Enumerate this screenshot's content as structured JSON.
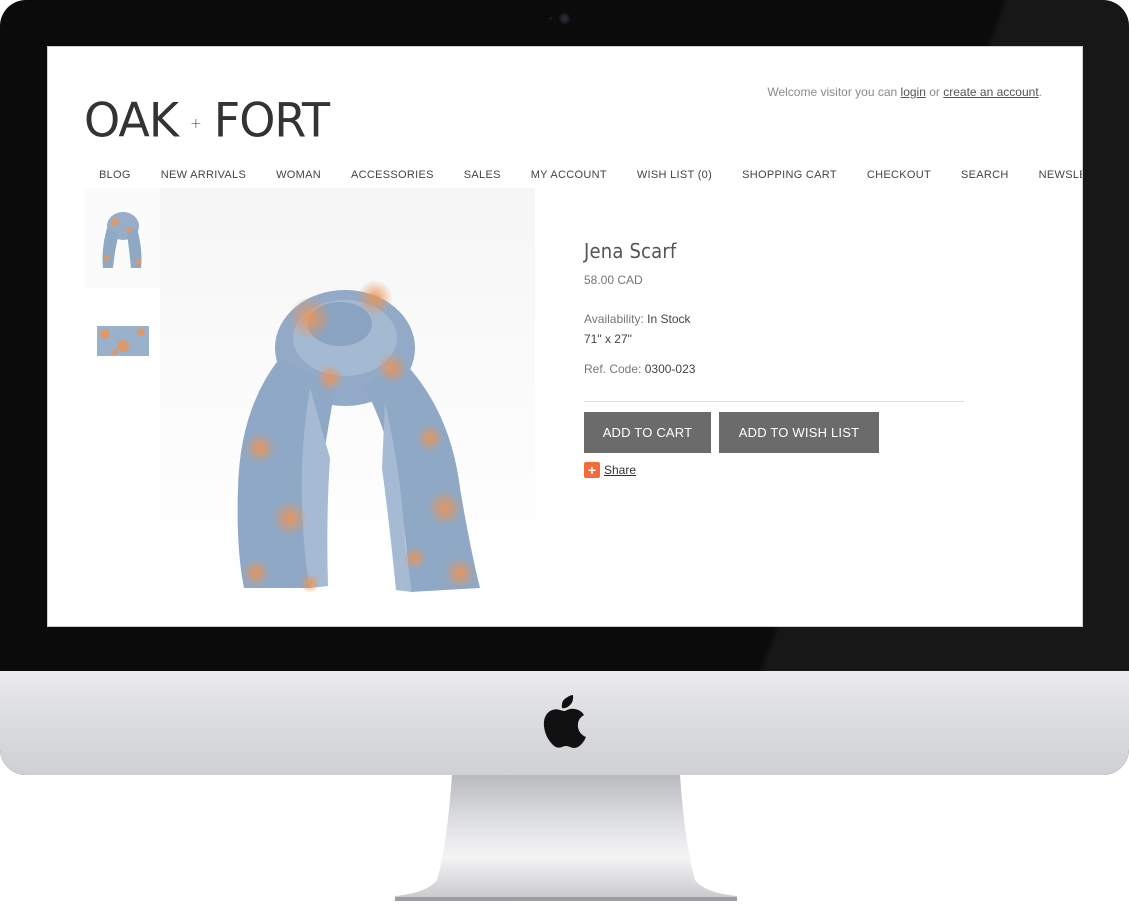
{
  "header": {
    "welcome_prefix": "Welcome visitor you can",
    "login_label": "login",
    "or_text": "or",
    "create_account_label": "create an account",
    "period": ".",
    "logo_left": "OAK",
    "logo_plus": "+",
    "logo_right": "FORT"
  },
  "nav": {
    "items": [
      {
        "label": "BLOG"
      },
      {
        "label": "NEW ARRIVALS"
      },
      {
        "label": "WOMAN"
      },
      {
        "label": "ACCESSORIES"
      },
      {
        "label": "SALES"
      },
      {
        "label": "MY ACCOUNT"
      },
      {
        "label": "WISH LIST (0)"
      },
      {
        "label": "SHOPPING CART"
      },
      {
        "label": "CHECKOUT"
      },
      {
        "label": "SEARCH"
      },
      {
        "label": "NEWSLETTER"
      }
    ]
  },
  "product": {
    "title": "Jena Scarf",
    "price": "58.00 CAD",
    "availability_label": "Availability:",
    "availability_value": "In Stock",
    "size": "71\" x 27\"",
    "ref_label": "Ref. Code:",
    "ref_value": "0300-023"
  },
  "actions": {
    "add_to_cart": "ADD TO CART",
    "add_to_wish_list": "ADD TO WISH LIST",
    "share_label": "Share"
  },
  "colors": {
    "button_bg": "#6b6b6b",
    "share_icon": "#f26b3a",
    "scarf_blue": "#8fa9c6",
    "scarf_orange": "#e8955a"
  }
}
